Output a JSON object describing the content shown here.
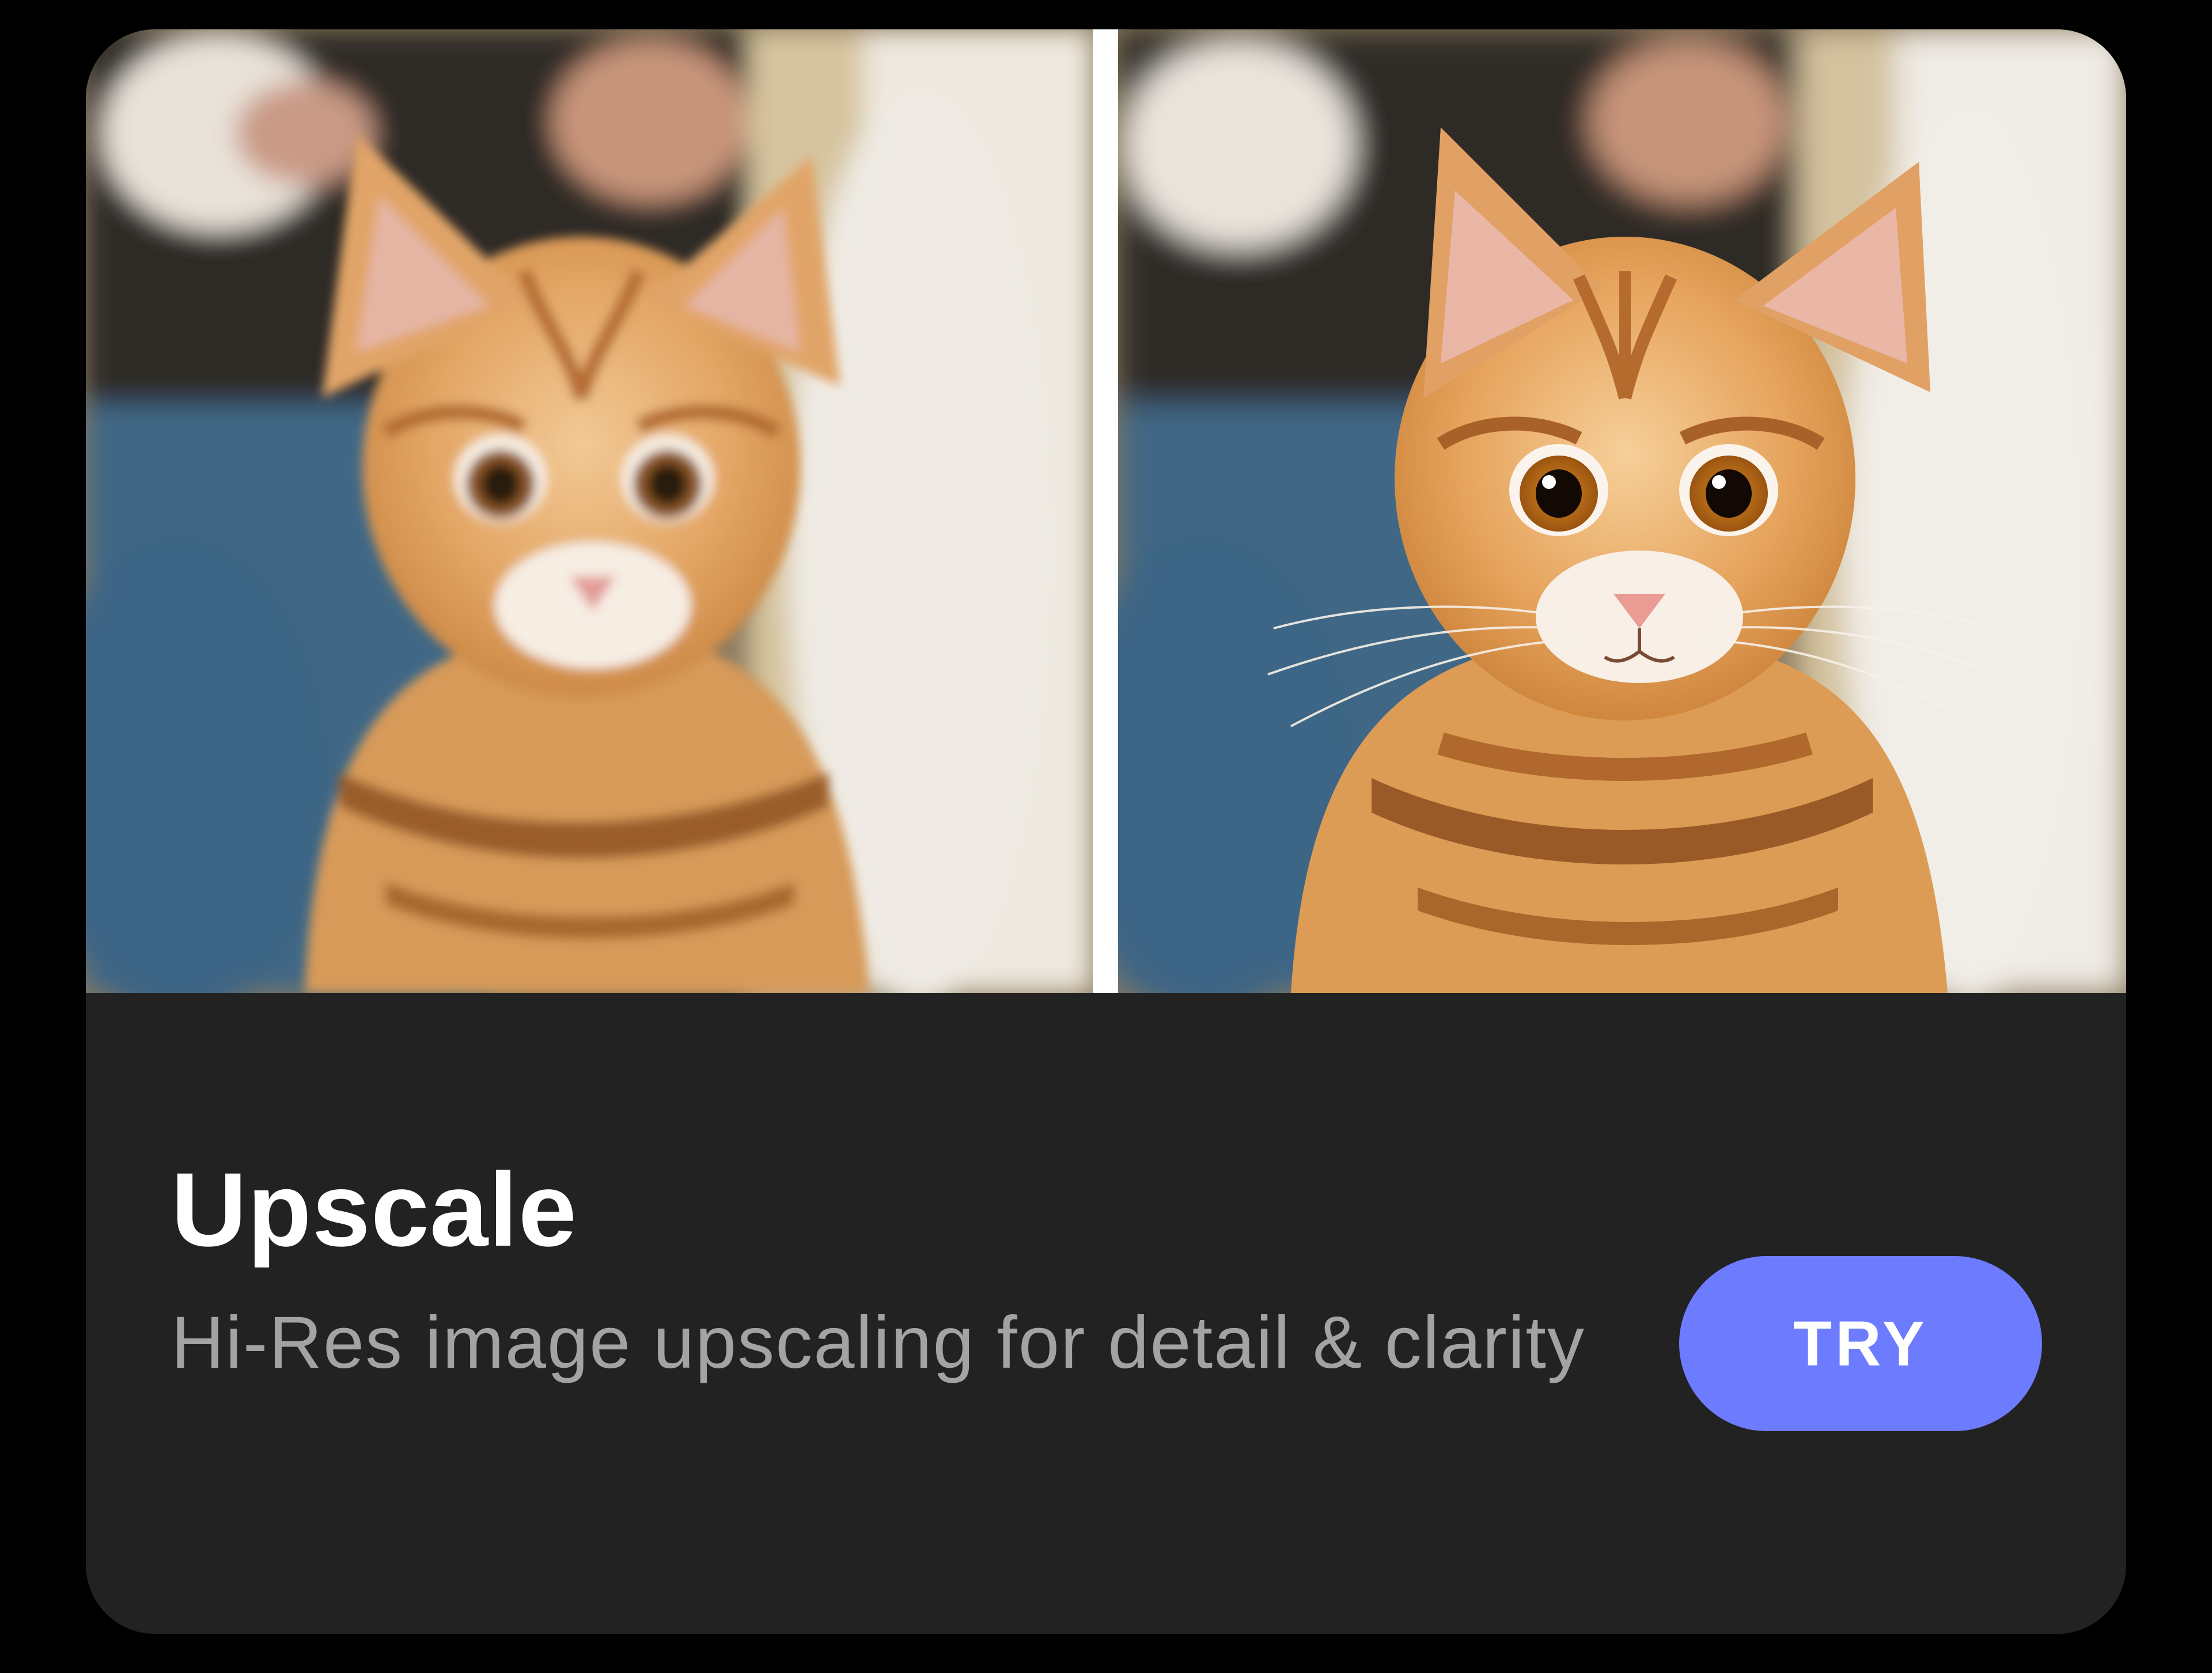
{
  "card": {
    "title": "Upscale",
    "description": "Hi-Res image upscaling for detail & clarity",
    "button_label": "TRY"
  },
  "images": {
    "before": {
      "kind": "low-resolution blurry cat photo"
    },
    "after": {
      "kind": "high-resolution sharp cat photo"
    }
  },
  "colors": {
    "page_background": "#000000",
    "card_background": "#222222",
    "title": "#ffffff",
    "description": "#a3a3a3",
    "button": "#6d7bff",
    "button_text": "#ffffff",
    "divider": "#ffffff"
  }
}
